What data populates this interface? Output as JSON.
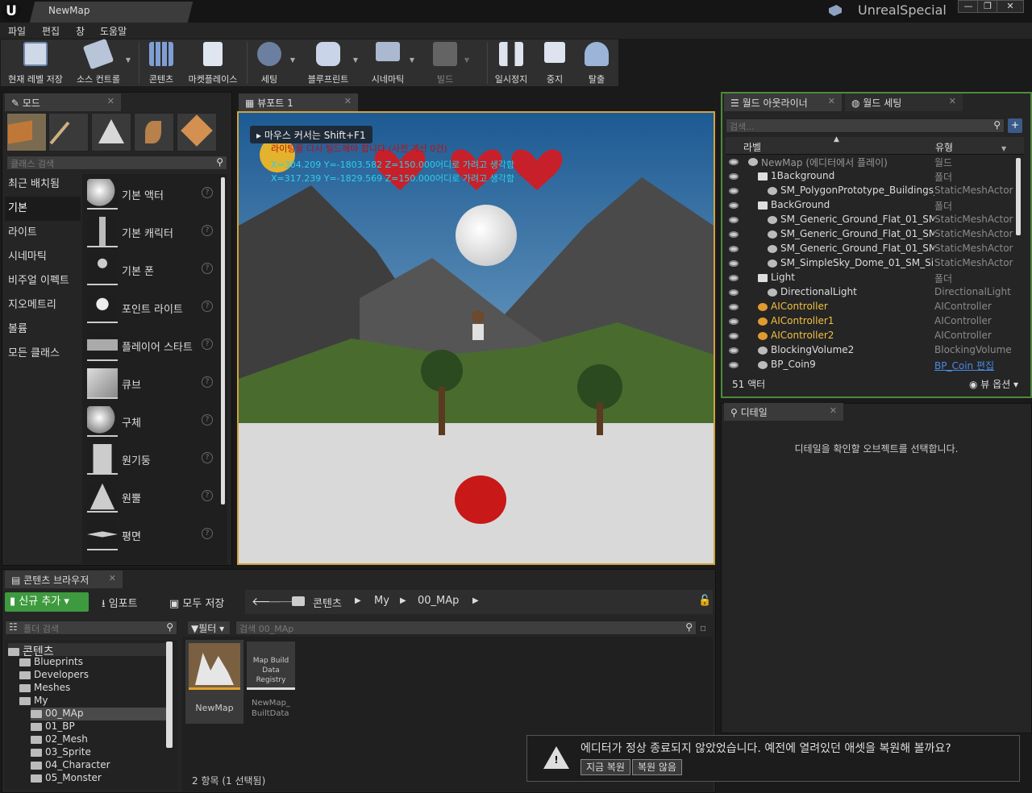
{
  "app": {
    "tab_title": "NewMap",
    "project": "UnrealSpecial"
  },
  "window_buttons": [
    "—",
    "❐",
    "✕"
  ],
  "menu": [
    "파일",
    "편집",
    "창",
    "도움말"
  ],
  "toolbar": [
    {
      "label": "현재 레벨 저장",
      "icon": "save-icon"
    },
    {
      "label": "소스 컨트롤",
      "icon": "source-control-icon"
    },
    {
      "label": "콘텐츠",
      "icon": "content-icon"
    },
    {
      "label": "마켓플레이스",
      "icon": "marketplace-icon"
    },
    {
      "label": "세팅",
      "icon": "settings-icon"
    },
    {
      "label": "블루프린트",
      "icon": "blueprint-icon"
    },
    {
      "label": "시네마틱",
      "icon": "cinematics-icon"
    },
    {
      "label": "빌드",
      "icon": "build-icon"
    },
    {
      "label": "일시정지",
      "icon": "pause-icon"
    },
    {
      "label": "중지",
      "icon": "stop-icon"
    },
    {
      "label": "탈출",
      "icon": "eject-icon"
    }
  ],
  "modes": {
    "tab_label": "모드",
    "search_placeholder": "클래스 검색",
    "categories": [
      "최근 배치됨",
      "기본",
      "라이트",
      "시네마틱",
      "비주얼 이펙트",
      "지오메트리",
      "볼륨",
      "모든 클래스"
    ],
    "actors": [
      "기본 액터",
      "기본 캐릭터",
      "기본 폰",
      "포인트 라이트",
      "플레이어 스타트",
      "큐브",
      "구체",
      "원기둥",
      "원뿔",
      "평면"
    ]
  },
  "viewport": {
    "tab_label": "뷰포트 1",
    "hint": "마우스 커서는 Shift+F1",
    "overlay_red": "라이팅을 다시 빌드해야 합니다 (사전 계산 0건)",
    "overlay_line1": "X=304.209 Y=-1803.582 Z=150.000어디로 가려고 생각함",
    "overlay_line2": "X=317.239 Y=-1829.569 Z=150.000어디로 가려고 생각함"
  },
  "outliner": {
    "tab_label": "월드 아웃라이너",
    "tab2_label": "월드 세팅",
    "search_placeholder": "검색...",
    "col_label": "라벨",
    "col_type": "유형",
    "rows": [
      {
        "name": "NewMap (에디터에서 플레이)",
        "type": "월드",
        "indent": 0,
        "gray": true
      },
      {
        "name": "1Background",
        "type": "폴더",
        "indent": 1
      },
      {
        "name": "SM_PolygonPrototype_Buildings_",
        "type": "StaticMeshActor",
        "indent": 2
      },
      {
        "name": "BackGround",
        "type": "폴더",
        "indent": 1
      },
      {
        "name": "SM_Generic_Ground_Flat_01_SM_",
        "type": "StaticMeshActor",
        "indent": 2
      },
      {
        "name": "SM_Generic_Ground_Flat_01_SM_",
        "type": "StaticMeshActor",
        "indent": 2
      },
      {
        "name": "SM_Generic_Ground_Flat_01_SM_",
        "type": "StaticMeshActor",
        "indent": 2
      },
      {
        "name": "SM_SimpleSky_Dome_01_SM_Sim",
        "type": "StaticMeshActor",
        "indent": 2
      },
      {
        "name": "Light",
        "type": "폴더",
        "indent": 1
      },
      {
        "name": "DirectionalLight",
        "type": "DirectionalLight",
        "indent": 2
      },
      {
        "name": "AIController",
        "type": "AIController",
        "indent": 1,
        "yellow": true
      },
      {
        "name": "AIController1",
        "type": "AIController",
        "indent": 1,
        "yellow": true
      },
      {
        "name": "AIController2",
        "type": "AIController",
        "indent": 1,
        "yellow": true
      },
      {
        "name": "BlockingVolume2",
        "type": "BlockingVolume",
        "indent": 1
      },
      {
        "name": "BP_Coin9",
        "type": "BP_Coin 편집",
        "indent": 1,
        "link": true
      }
    ],
    "count": "51 액터",
    "view_options": "뷰 옵션"
  },
  "details": {
    "tab_label": "디테일",
    "message": "디테일을 확인할 오브젝트를 선택합니다."
  },
  "content_browser": {
    "tab_label": "콘텐츠 브라우저",
    "add_new": "신규 추가",
    "import": "임포트",
    "save_all": "모두 저장",
    "breadcrumb": [
      "콘텐츠",
      "My",
      "00_MAp"
    ],
    "folder_search": "폴더 검색",
    "filter": "필터",
    "asset_search": "검색 00_MAp",
    "tree": [
      {
        "name": "콘텐츠",
        "indent": 0,
        "root": true
      },
      {
        "name": "Blueprints",
        "indent": 1
      },
      {
        "name": "Developers",
        "indent": 1
      },
      {
        "name": "Meshes",
        "indent": 1
      },
      {
        "name": "My",
        "indent": 1
      },
      {
        "name": "00_MAp",
        "indent": 2,
        "selected": true
      },
      {
        "name": "01_BP",
        "indent": 2
      },
      {
        "name": "02_Mesh",
        "indent": 2
      },
      {
        "name": "03_Sprite",
        "indent": 2
      },
      {
        "name": "04_Character",
        "indent": 2
      },
      {
        "name": "05_Monster",
        "indent": 2
      }
    ],
    "assets": [
      {
        "name": "NewMap",
        "thumb_text": ""
      },
      {
        "name": "NewMap_ BuiltData",
        "thumb_text": "Map Build Data Registry"
      }
    ],
    "status": "2 항목 (1 선택됨)"
  },
  "toast": {
    "message": "에디터가 정상 종료되지 않았었습니다. 예전에 열려있던 애셋을 복원해 볼까요?",
    "restore_now": "지금 복원",
    "dont_restore": "복원 않음"
  }
}
